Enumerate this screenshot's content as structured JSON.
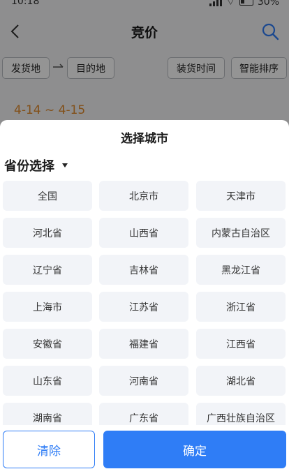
{
  "status_bar": {
    "time": "10:18",
    "battery": "30%"
  },
  "nav": {
    "title": "竞价"
  },
  "filters": {
    "origin": "发货地",
    "destination": "目的地",
    "load_time": "装货时间",
    "smart_sort": "智能排序"
  },
  "listing": {
    "date_range": "4-14 ~ 4-15"
  },
  "sheet": {
    "title": "选择城市",
    "province_label": "省份选择",
    "provinces": [
      "全国",
      "北京市",
      "天津市",
      "河北省",
      "山西省",
      "内蒙古自治区",
      "辽宁省",
      "吉林省",
      "黑龙江省",
      "上海市",
      "江苏省",
      "浙江省",
      "安徽省",
      "福建省",
      "江西省",
      "山东省",
      "河南省",
      "湖北省",
      "湖南省",
      "广东省",
      "广西壮族自治区"
    ],
    "clear_label": "清除",
    "confirm_label": "确定"
  },
  "colors": {
    "accent": "#2f7df6",
    "date_orange": "#e08a2c",
    "cell_bg": "#f2f4f8"
  }
}
